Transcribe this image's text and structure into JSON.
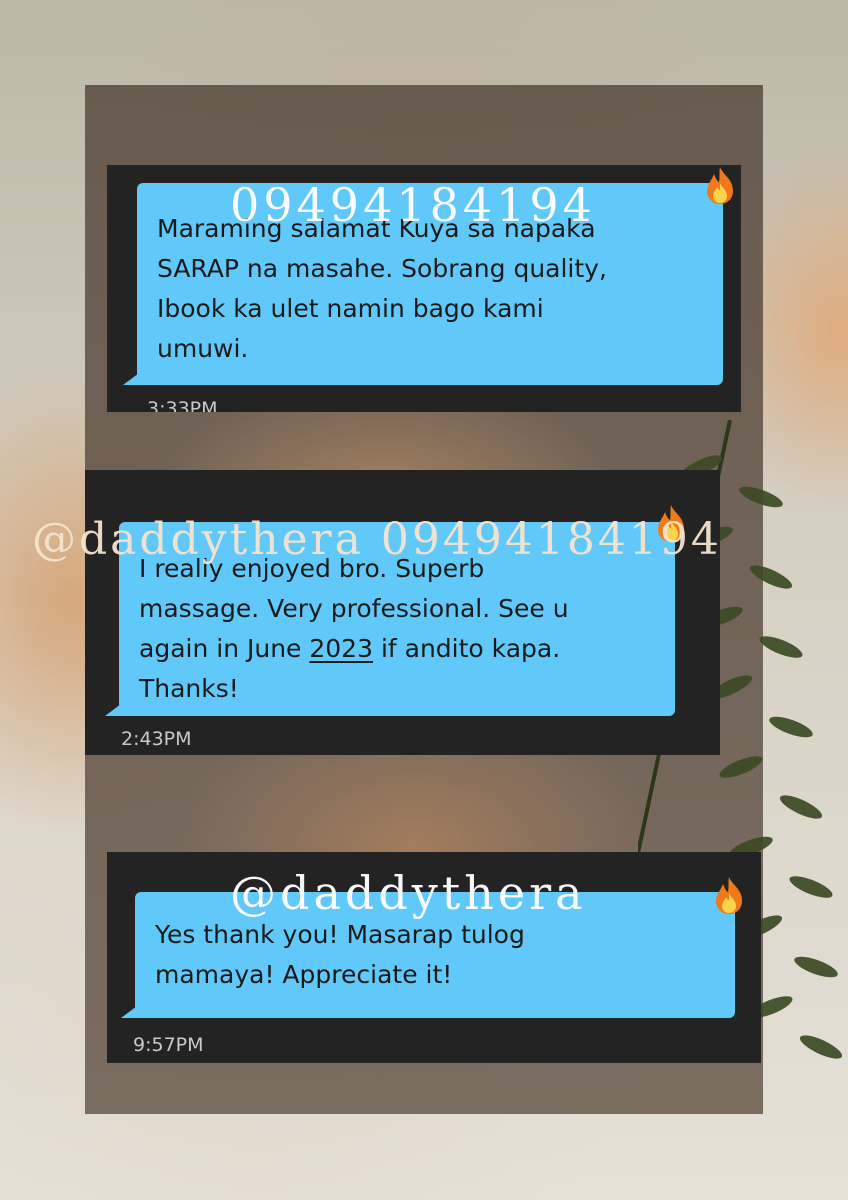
{
  "watermarks": {
    "top": "09494184194",
    "middle": "@daddythera 09494184194",
    "bottom": "@daddythera"
  },
  "messages": [
    {
      "text": "Maraming salamat Kuya sa napaka\nSARAP na masahe. Sobrang quality,\nIbook ka ulet namin bago kami\numuwi.",
      "time": "3:33PM",
      "icon": "fire-icon"
    },
    {
      "text_before": "I really enjoyed bro. Superb\nmassage. Very professional. See u\nagain in June ",
      "underlined": "2023",
      "text_after": " if andito kapa.\nThanks!",
      "time": "2:43PM",
      "icon": "fire-icon"
    },
    {
      "text": "Yes thank you! Masarap tulog\nmamaya! Appreciate it!",
      "time": "9:57PM",
      "icon": "fire-icon"
    }
  ],
  "colors": {
    "bubble": "#61c8fa",
    "card": "#232323",
    "frame": "#625448"
  }
}
